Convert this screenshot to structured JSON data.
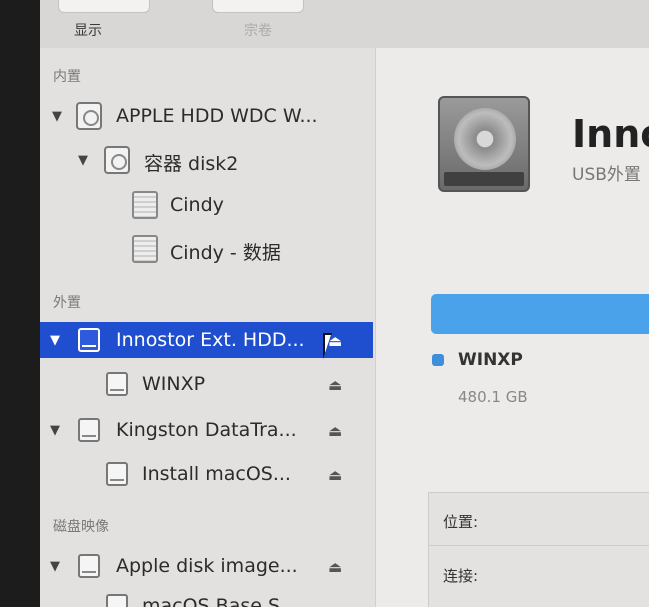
{
  "toolbar": {
    "display_label": "显示",
    "volume_label": "宗卷"
  },
  "sidebar": {
    "internal_heading": "内置",
    "external_heading": "外置",
    "disk_images_heading": "磁盘映像",
    "items": [
      {
        "label": "APPLE HDD WDC W...",
        "kind": "disk"
      },
      {
        "label": "容器 disk2",
        "kind": "container"
      },
      {
        "label": "Cindy",
        "kind": "volume"
      },
      {
        "label": "Cindy - 数据",
        "kind": "volume"
      },
      {
        "label": "Innostor Ext. HDD...",
        "kind": "external",
        "selected": true
      },
      {
        "label": "WINXP",
        "kind": "external-volume"
      },
      {
        "label": "Kingston DataTra...",
        "kind": "external"
      },
      {
        "label": "Install macOS...",
        "kind": "external-volume"
      },
      {
        "label": "Apple disk image...",
        "kind": "disk-image"
      },
      {
        "label": "macOS Base S...",
        "kind": "external-volume"
      }
    ],
    "eject_glyph": "⏏"
  },
  "detail": {
    "title": "Inno",
    "subtitle": "USB外置",
    "usage_color": "#4aa3ea",
    "partition": {
      "name": "WINXP",
      "size": "480.1 GB",
      "color": "#3d8fd9"
    },
    "info": {
      "location_label": "位置:",
      "connection_label": "连接:"
    }
  },
  "colors": {
    "selection": "#1f4fcf"
  }
}
